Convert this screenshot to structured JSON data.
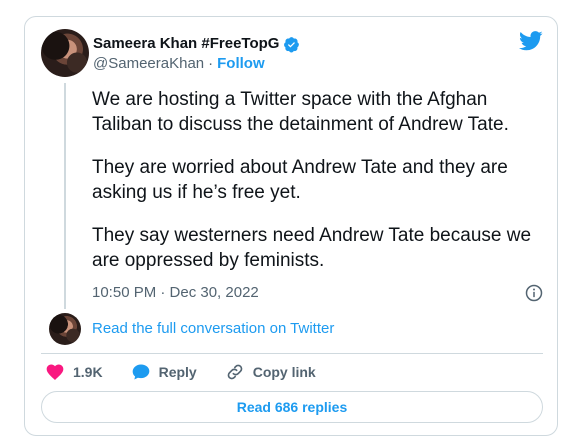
{
  "author": {
    "display_name": "Sameera Khan #FreeTopG",
    "handle": "@SameeraKhan",
    "separator": "·",
    "follow_label": "Follow"
  },
  "tweet": {
    "paragraphs": [
      "We are hosting a Twitter space with the Afghan Taliban to discuss the detainment of Andrew Tate.",
      "They are worried about Andrew Tate and they are asking us if he’s free yet.",
      "They say westerners need Andrew Tate because we are oppressed by feminists."
    ],
    "timestamp": "10:50 PM · Dec 30, 2022"
  },
  "conversation": {
    "read_full_label": "Read the full conversation on Twitter"
  },
  "actions": {
    "like_count": "1.9K",
    "reply_label": "Reply",
    "copy_link_label": "Copy link"
  },
  "replies_button": {
    "label": "Read 686 replies"
  },
  "colors": {
    "accent": "#1d9bf0",
    "like": "#f91880",
    "text": "#0f1419",
    "muted": "#536471",
    "border": "#cfd9de"
  },
  "icons": [
    "twitter-bird-icon",
    "verified-badge-icon",
    "info-icon",
    "heart-icon",
    "reply-bubble-icon",
    "link-icon"
  ]
}
